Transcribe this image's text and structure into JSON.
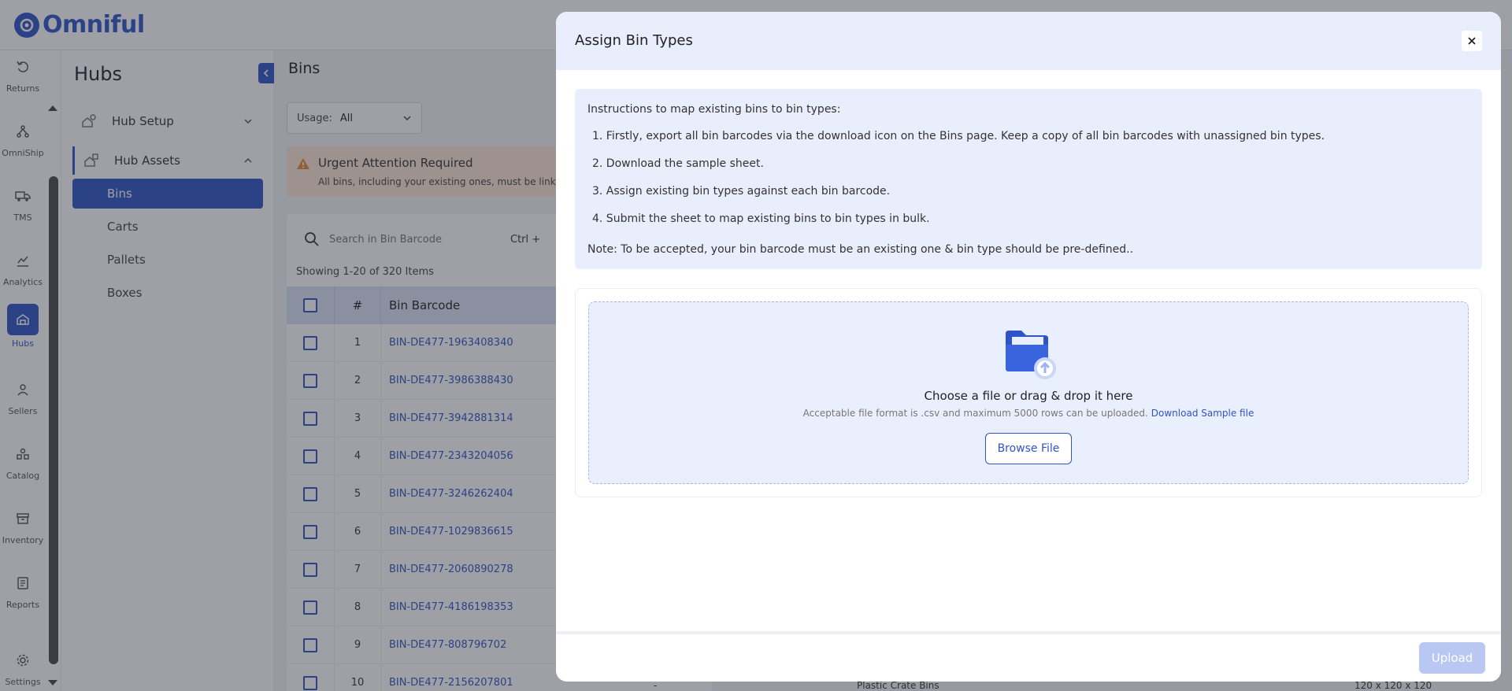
{
  "brand": {
    "name": "Omniful",
    "color": "#2f54c9"
  },
  "rail": {
    "items": [
      {
        "label": "Returns",
        "icon": "returns-icon"
      },
      {
        "label": "OmniShip",
        "icon": "omniship-icon"
      },
      {
        "label": "TMS",
        "icon": "truck-icon"
      },
      {
        "label": "Analytics",
        "icon": "analytics-icon"
      },
      {
        "label": "Hubs",
        "icon": "hubs-icon",
        "active": true
      },
      {
        "label": "Sellers",
        "icon": "seller-icon"
      },
      {
        "label": "Catalog",
        "icon": "catalog-icon"
      },
      {
        "label": "Inventory",
        "icon": "inventory-icon"
      },
      {
        "label": "Reports",
        "icon": "reports-icon"
      },
      {
        "label": "Settings",
        "icon": "gear-icon"
      }
    ]
  },
  "subnav": {
    "title": "Hubs",
    "groups": [
      {
        "label": "Hub Setup",
        "icon": "hub-setup-icon"
      },
      {
        "label": "Hub Assets",
        "icon": "hub-assets-icon"
      }
    ],
    "sub_items": [
      "Bins",
      "Carts",
      "Pallets",
      "Boxes"
    ],
    "active_sub": "Bins"
  },
  "page": {
    "title": "Bins",
    "usage_label": "Usage:",
    "usage_value": "All",
    "alert_title": "Urgent Attention Required",
    "alert_desc": "All bins, including your existing ones, must be link",
    "search_placeholder": "Search in Bin Barcode",
    "search_shortcut": "Ctrl +",
    "showing": "Showing 1-20 of 320 Items",
    "columns": {
      "num": "#",
      "barcode": "Bin Barcode"
    },
    "rows": [
      {
        "num": "1",
        "barcode": "BIN-DE477-1963408340"
      },
      {
        "num": "2",
        "barcode": "BIN-DE477-3986388430"
      },
      {
        "num": "3",
        "barcode": "BIN-DE477-3942881314"
      },
      {
        "num": "4",
        "barcode": "BIN-DE477-2343204056"
      },
      {
        "num": "5",
        "barcode": "BIN-DE477-3246262404"
      },
      {
        "num": "6",
        "barcode": "BIN-DE477-1029836615"
      },
      {
        "num": "7",
        "barcode": "BIN-DE477-2060890278"
      },
      {
        "num": "8",
        "barcode": "BIN-DE477-4186198353"
      },
      {
        "num": "9",
        "barcode": "BIN-DE477-808796702"
      },
      {
        "num": "10",
        "barcode": "BIN-DE477-2156207801"
      }
    ],
    "row10_extra": {
      "dash": "-",
      "bin_type": "Plastic Crate Bins",
      "dims": "120 x 120 x 120"
    }
  },
  "modal": {
    "title": "Assign Bin Types",
    "instructions_heading": "Instructions to map existing bins to bin types:",
    "steps": [
      "1. Firstly, export all bin barcodes via the download icon on the Bins page. Keep a copy of all bin barcodes with unassigned bin types.",
      "2. Download the sample sheet.",
      "3. Assign existing bin types against each bin barcode.",
      "4. Submit the sheet to map existing bins to bin types in bulk."
    ],
    "note": "Note: To be accepted, your bin barcode must be an existing one & bin type should be pre-defined..",
    "dropzone_title": "Choose a file or drag & drop it here",
    "dropzone_sub": "Acceptable file format is .csv and maximum 5000 rows can be uploaded.",
    "download_link": "Download Sample file",
    "browse_label": "Browse File",
    "upload_label": "Upload"
  }
}
